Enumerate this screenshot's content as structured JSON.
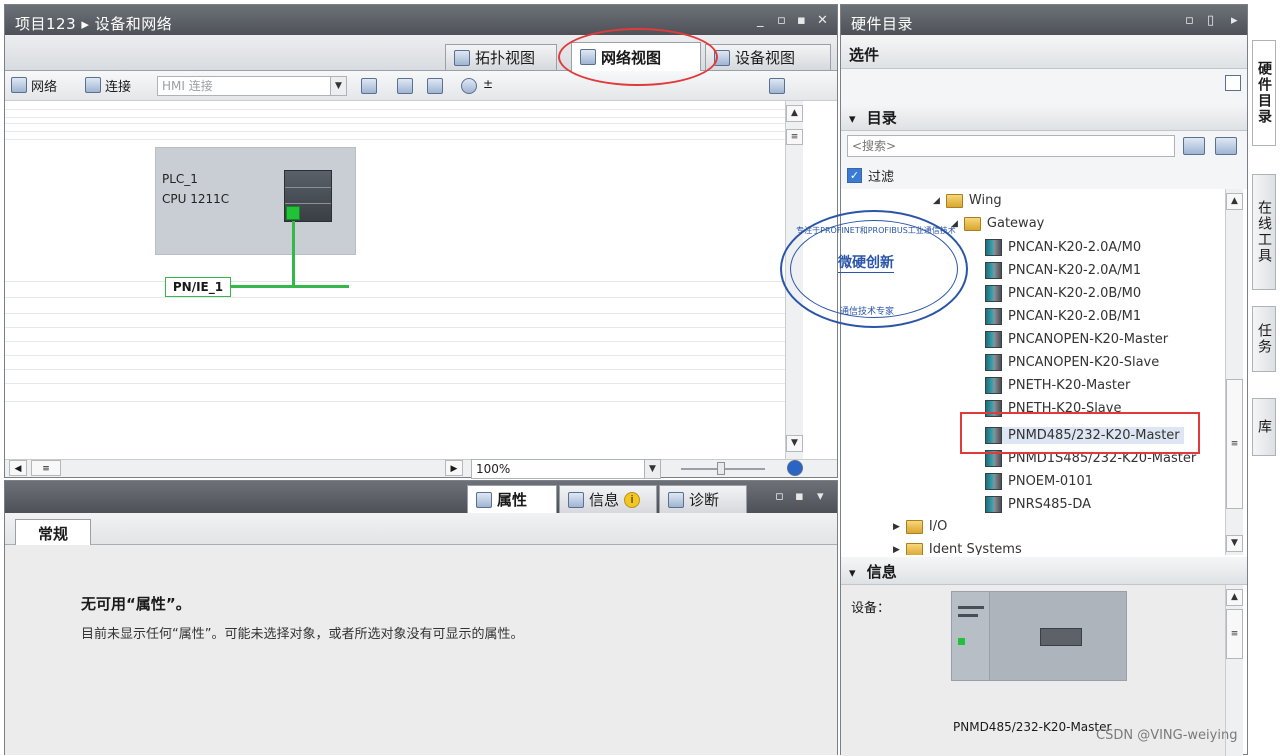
{
  "left_panel": {
    "title": "项目123 ▸ 设备和网络",
    "window_controls": [
      "_",
      "▫",
      "▪",
      "✕"
    ],
    "view_tabs": [
      {
        "label": "拓扑视图",
        "icon": "topology-icon",
        "active": false
      },
      {
        "label": "网络视图",
        "icon": "network-icon",
        "active": true
      },
      {
        "label": "设备视图",
        "icon": "device-icon",
        "active": false
      }
    ],
    "toolbar": {
      "network_label": "网络",
      "connections_label": "连接",
      "hmi_combo": "HMI 连接"
    },
    "canvas": {
      "plc_name": "PLC_1",
      "plc_cpu": "CPU 1211C",
      "subnet_label": "PN/IE_1"
    },
    "zoom": {
      "value": "100%"
    }
  },
  "bottom_panel": {
    "tabs": [
      {
        "label": "属性",
        "icon": "properties-icon"
      },
      {
        "label": "信息",
        "icon": "info-icon"
      },
      {
        "label": "诊断",
        "icon": "diagnostics-icon"
      }
    ],
    "general_tab": "常规",
    "heading": "无可用“属性”。",
    "message": "目前未显示任何“属性”。可能未选择对象，或者所选对象没有可显示的属性。"
  },
  "right_panel": {
    "title": "硬件目录",
    "options_label": "选件",
    "catalog": {
      "header": "目录",
      "search_placeholder": "<搜索>",
      "filter_label": "过滤",
      "tree": [
        {
          "label": "Wing",
          "type": "folder",
          "level": 0
        },
        {
          "label": "Gateway",
          "type": "folder",
          "level": 1
        },
        {
          "label": "PNCAN-K20-2.0A/M0",
          "type": "device",
          "level": 2
        },
        {
          "label": "PNCAN-K20-2.0A/M1",
          "type": "device",
          "level": 2
        },
        {
          "label": "PNCAN-K20-2.0B/M0",
          "type": "device",
          "level": 2
        },
        {
          "label": "PNCAN-K20-2.0B/M1",
          "type": "device",
          "level": 2
        },
        {
          "label": "PNCANOPEN-K20-Master",
          "type": "device",
          "level": 2
        },
        {
          "label": "PNCANOPEN-K20-Slave",
          "type": "device",
          "level": 2
        },
        {
          "label": "PNETH-K20-Master",
          "type": "device",
          "level": 2
        },
        {
          "label": "PNETH-K20-Slave",
          "type": "device",
          "level": 2
        },
        {
          "label": "PNMD485/232-K20-Master",
          "type": "device",
          "level": 2,
          "selected": true
        },
        {
          "label": "PNMD1S485/232-K20-Master",
          "type": "device",
          "level": 2
        },
        {
          "label": "PNOEM-0101",
          "type": "device",
          "level": 2
        },
        {
          "label": "PNRS485-DA",
          "type": "device",
          "level": 2
        },
        {
          "label": "I/O",
          "type": "folder",
          "level": 0
        },
        {
          "label": "Ident Systems",
          "type": "folder",
          "level": 0
        }
      ]
    },
    "info": {
      "header": "信息",
      "device_label": "设备：",
      "device_name": "PNMD485/232-K20-Master"
    }
  },
  "side_tabs": [
    "硬件目录",
    "在线工具",
    "任务",
    "库"
  ],
  "stamp": {
    "center_text": "微硬创新",
    "ring_text_top": "专注于PROFINET和PROFIBUS工业通信技术",
    "ring_text_bottom": "通信技术专家"
  },
  "watermark": "CSDN @VING-weiying"
}
